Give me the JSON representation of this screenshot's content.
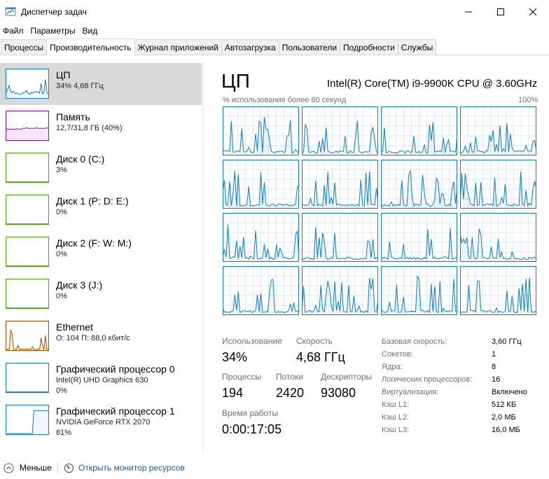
{
  "window": {
    "title": "Диспетчер задач"
  },
  "menu": [
    {
      "label": "Файл"
    },
    {
      "label": "Параметры"
    },
    {
      "label": "Вид"
    }
  ],
  "tabs": [
    {
      "label": "Процессы",
      "active": false
    },
    {
      "label": "Производительность",
      "active": true
    },
    {
      "label": "Журнал приложений",
      "active": false
    },
    {
      "label": "Автозагрузка",
      "active": false
    },
    {
      "label": "Пользователи",
      "active": false
    },
    {
      "label": "Подробности",
      "active": false
    },
    {
      "label": "Службы",
      "active": false
    }
  ],
  "sidebar": [
    {
      "title": "ЦП",
      "line1": "34%  4,68 ГГц",
      "line2": "",
      "color": "#117dbb",
      "active": true
    },
    {
      "title": "Память",
      "line1": "12,7/31,8 ГБ (40%)",
      "line2": "",
      "color": "#8b12ae",
      "active": false
    },
    {
      "title": "Диск 0 (C:)",
      "line1": "3%",
      "line2": "",
      "color": "#4da60c",
      "active": false
    },
    {
      "title": "Диск 1 (P: D: E:)",
      "line1": "0%",
      "line2": "",
      "color": "#4da60c",
      "active": false
    },
    {
      "title": "Диск 2 (F: W: M:)",
      "line1": "0%",
      "line2": "",
      "color": "#4da60c",
      "active": false
    },
    {
      "title": "Диск 3 (J:)",
      "line1": "0%",
      "line2": "",
      "color": "#4da60c",
      "active": false
    },
    {
      "title": "Ethernet",
      "line1": "О: 104  П: 88,0 кбит/с",
      "line2": "",
      "color": "#a74f01",
      "active": false
    },
    {
      "title": "Графический процессор 0",
      "line1": "Intel(R) UHD Graphics 630",
      "line2": "0%",
      "color": "#117dbb",
      "active": false
    },
    {
      "title": "Графический процессор 1",
      "line1": "NVIDIA GeForce RTX 2070",
      "line2": "81%",
      "color": "#117dbb",
      "active": false
    }
  ],
  "main": {
    "title": "ЦП",
    "cpu_name": "Intel(R) Core(TM) i9-9900K CPU @ 3.60GHz",
    "graph_label_left": "% использования более 60 секунд",
    "graph_label_right": "100%"
  },
  "stats": {
    "usage_label": "Использование",
    "usage_value": "34%",
    "speed_label": "Скорость",
    "speed_value": "4,68 ГГц",
    "processes_label": "Процессы",
    "processes_value": "194",
    "threads_label": "Потоки",
    "threads_value": "2420",
    "handles_label": "Дескрипторы",
    "handles_value": "93080",
    "uptime_label": "Время работы",
    "uptime_value": "0:00:17:05"
  },
  "specs": [
    {
      "key": "Базовая скорость:",
      "value": "3,60 ГГц"
    },
    {
      "key": "Сокетов:",
      "value": "1"
    },
    {
      "key": "Ядра:",
      "value": "8"
    },
    {
      "key": "Логических процессоров:",
      "value": "16"
    },
    {
      "key": "Виртуализация:",
      "value": "Включено"
    },
    {
      "key": "Кэш L1:",
      "value": "512 КБ"
    },
    {
      "key": "Кэш L2:",
      "value": "2,0 МБ"
    },
    {
      "key": "Кэш L3:",
      "value": "16,0 МБ"
    }
  ],
  "footer": {
    "less_label": "Меньше",
    "monitor_label": "Открыть монитор ресурсов"
  },
  "colors": {
    "cpu": "#117dbb",
    "cpu_fill": "#f1f6fa",
    "grid_line": "#d9eaf4"
  }
}
